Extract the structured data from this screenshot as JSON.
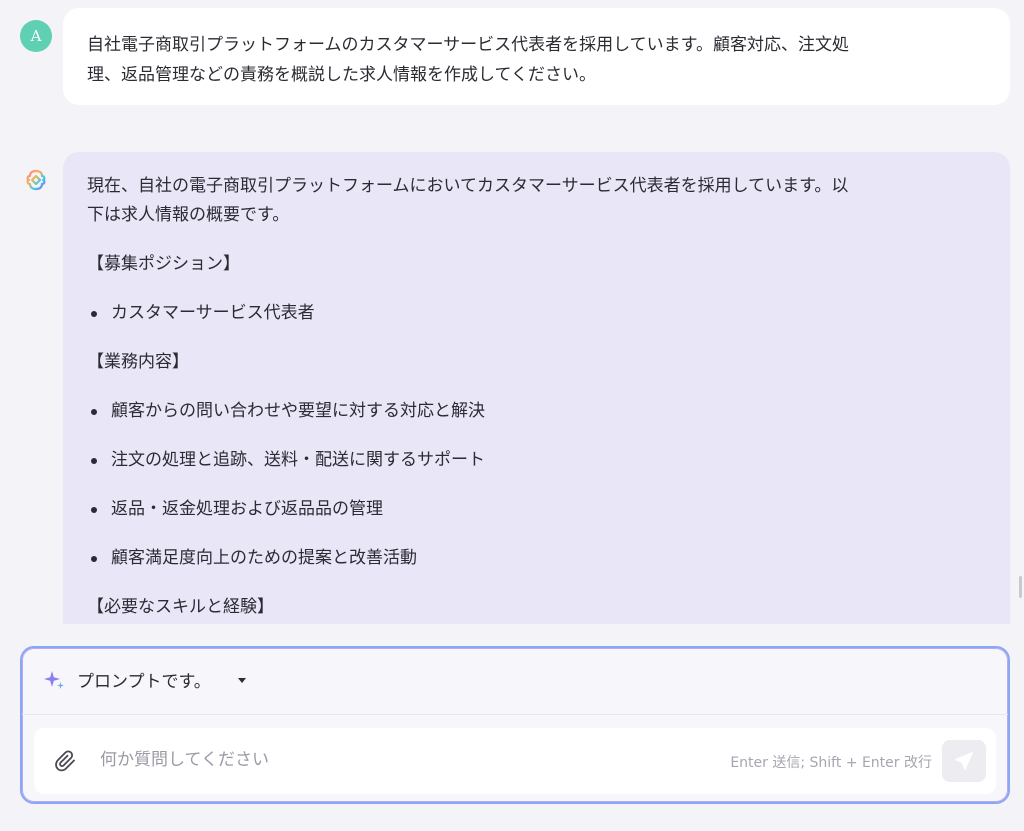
{
  "user": {
    "avatar_letter": "A",
    "message_line1": "自社電子商取引プラットフォームのカスタマーサービス代表者を採用しています。顧客対応、注文処",
    "message_line2": "理、返品管理などの責務を概説した求人情報を作成してください。"
  },
  "assistant": {
    "icon": "assistant-logo-icon",
    "intro_line1": "現在、自社の電子商取引プラットフォームにおいてカスタマーサービス代表者を採用しています。以",
    "intro_line2": "下は求人情報の概要です。",
    "sections": {
      "position_heading": "【募集ポジション】",
      "position_items": [
        "カスタマーサービス代表者"
      ],
      "duties_heading": "【業務内容】",
      "duties_items": [
        "顧客からの問い合わせや要望に対する対応と解決",
        "注文の処理と追跡、送料・配送に関するサポート",
        "返品・返金処理および返品品の管理",
        "顧客満足度向上のための提案と改善活動"
      ],
      "skills_heading": "【必要なスキルと経験】"
    }
  },
  "composer": {
    "prompt_label": "プロンプトです。",
    "sparkle_icon": "sparkle-icon",
    "placeholder": "何か質問してください",
    "hint": "Enter 送信; Shift + Enter 改行",
    "attach_icon": "paperclip-icon",
    "send_icon": "send-icon"
  },
  "colors": {
    "avatar": "#5fd0b3",
    "assistant_bubble": "#e8e6f7",
    "input_border": "#8aa7f2"
  }
}
